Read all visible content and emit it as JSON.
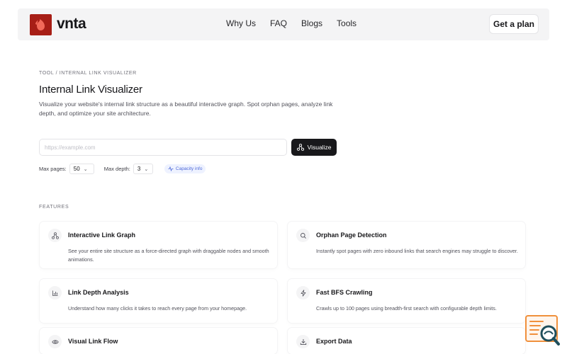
{
  "brand": {
    "name": "vnta",
    "logo_icon": "flame-logo-icon",
    "logo_color": "#a71e16"
  },
  "nav": {
    "links": [
      "Why Us",
      "FAQ",
      "Blogs",
      "Tools"
    ],
    "cta": "Get a plan"
  },
  "page": {
    "breadcrumb": "TOOL / INTERNAL LINK VISUALIZER",
    "title": "Internal Link Visualizer",
    "description": "Visualize your website's internal link structure as a beautiful interactive graph. Spot orphan pages, analyze link depth, and optimize your site architecture."
  },
  "form": {
    "url_placeholder": "https://example.com",
    "url_value": "",
    "submit_label": "Visualize",
    "max_pages_label": "Max pages:",
    "max_pages_value": "50",
    "max_depth_label": "Max depth:",
    "max_depth_value": "3",
    "capacity_label": "Capacity info"
  },
  "features": {
    "label": "FEATURES",
    "items": [
      {
        "title": "Interactive Link Graph",
        "text": "See your entire site structure as a force-directed graph with draggable nodes and smooth animations.",
        "icon": "graph-nodes-icon"
      },
      {
        "title": "Orphan Page Detection",
        "text": "Instantly spot pages with zero inbound links that search engines may struggle to discover.",
        "icon": "search-icon"
      },
      {
        "title": "Link Depth Analysis",
        "text": "Understand how many clicks it takes to reach every page from your homepage.",
        "icon": "bar-chart-icon"
      },
      {
        "title": "Fast BFS Crawling",
        "text": "Crawls up to 100 pages using breadth-first search with configurable depth limits.",
        "icon": "lightning-icon"
      },
      {
        "title": "Visual Link Flow",
        "text": "",
        "icon": "eye-icon"
      },
      {
        "title": "Export Data",
        "text": "",
        "icon": "download-icon"
      }
    ]
  },
  "colors": {
    "accent_dark": "#18181b",
    "nav_bg": "#f4f4f5",
    "capacity_badge": "#4f6ad8",
    "widget_accent": "#f0903c"
  }
}
